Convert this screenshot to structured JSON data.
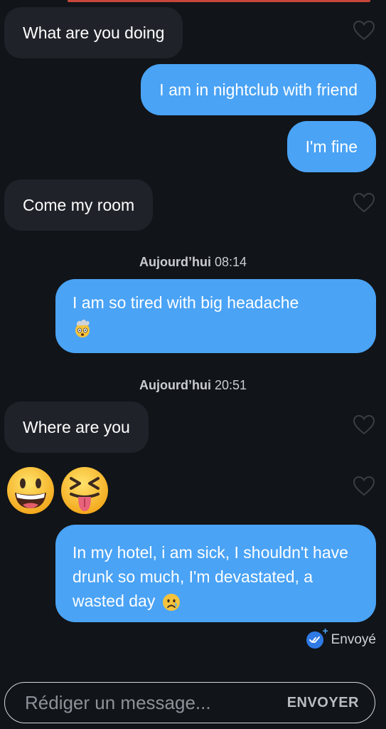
{
  "messages": [
    {
      "side": "received",
      "text": "What are you doing"
    },
    {
      "side": "sent",
      "text": "I am in nightclub with friend"
    },
    {
      "side": "sent",
      "text": "I'm fine"
    },
    {
      "side": "received",
      "text": "Come my room"
    },
    {
      "side": "sent",
      "text": "I am so tired with big headache",
      "emoji": "exploding-head-emoji"
    },
    {
      "side": "received",
      "text": "Where are you"
    },
    {
      "side": "received",
      "emoji": [
        "grinning-face-emoji",
        "squinting-tongue-emoji"
      ]
    },
    {
      "side": "sent",
      "text": "In my hotel, i am sick, I shouldn't have drunk so much, I'm devastated, a wasted day",
      "emoji": "crying-face-emoji"
    }
  ],
  "timestamps": [
    {
      "day": "Aujourd’hui",
      "time": "08:14"
    },
    {
      "day": "Aujourd’hui",
      "time": "20:51"
    }
  ],
  "status": {
    "label": "Envoyé",
    "icon": "double-check-icon"
  },
  "composer": {
    "placeholder": "Rédiger un message...",
    "send_label": "ENVOYER"
  },
  "colors": {
    "background": "#111418",
    "received_bubble": "#1f2329",
    "sent_bubble": "#4aa3f5",
    "heart_outline": "#3a3e45"
  }
}
